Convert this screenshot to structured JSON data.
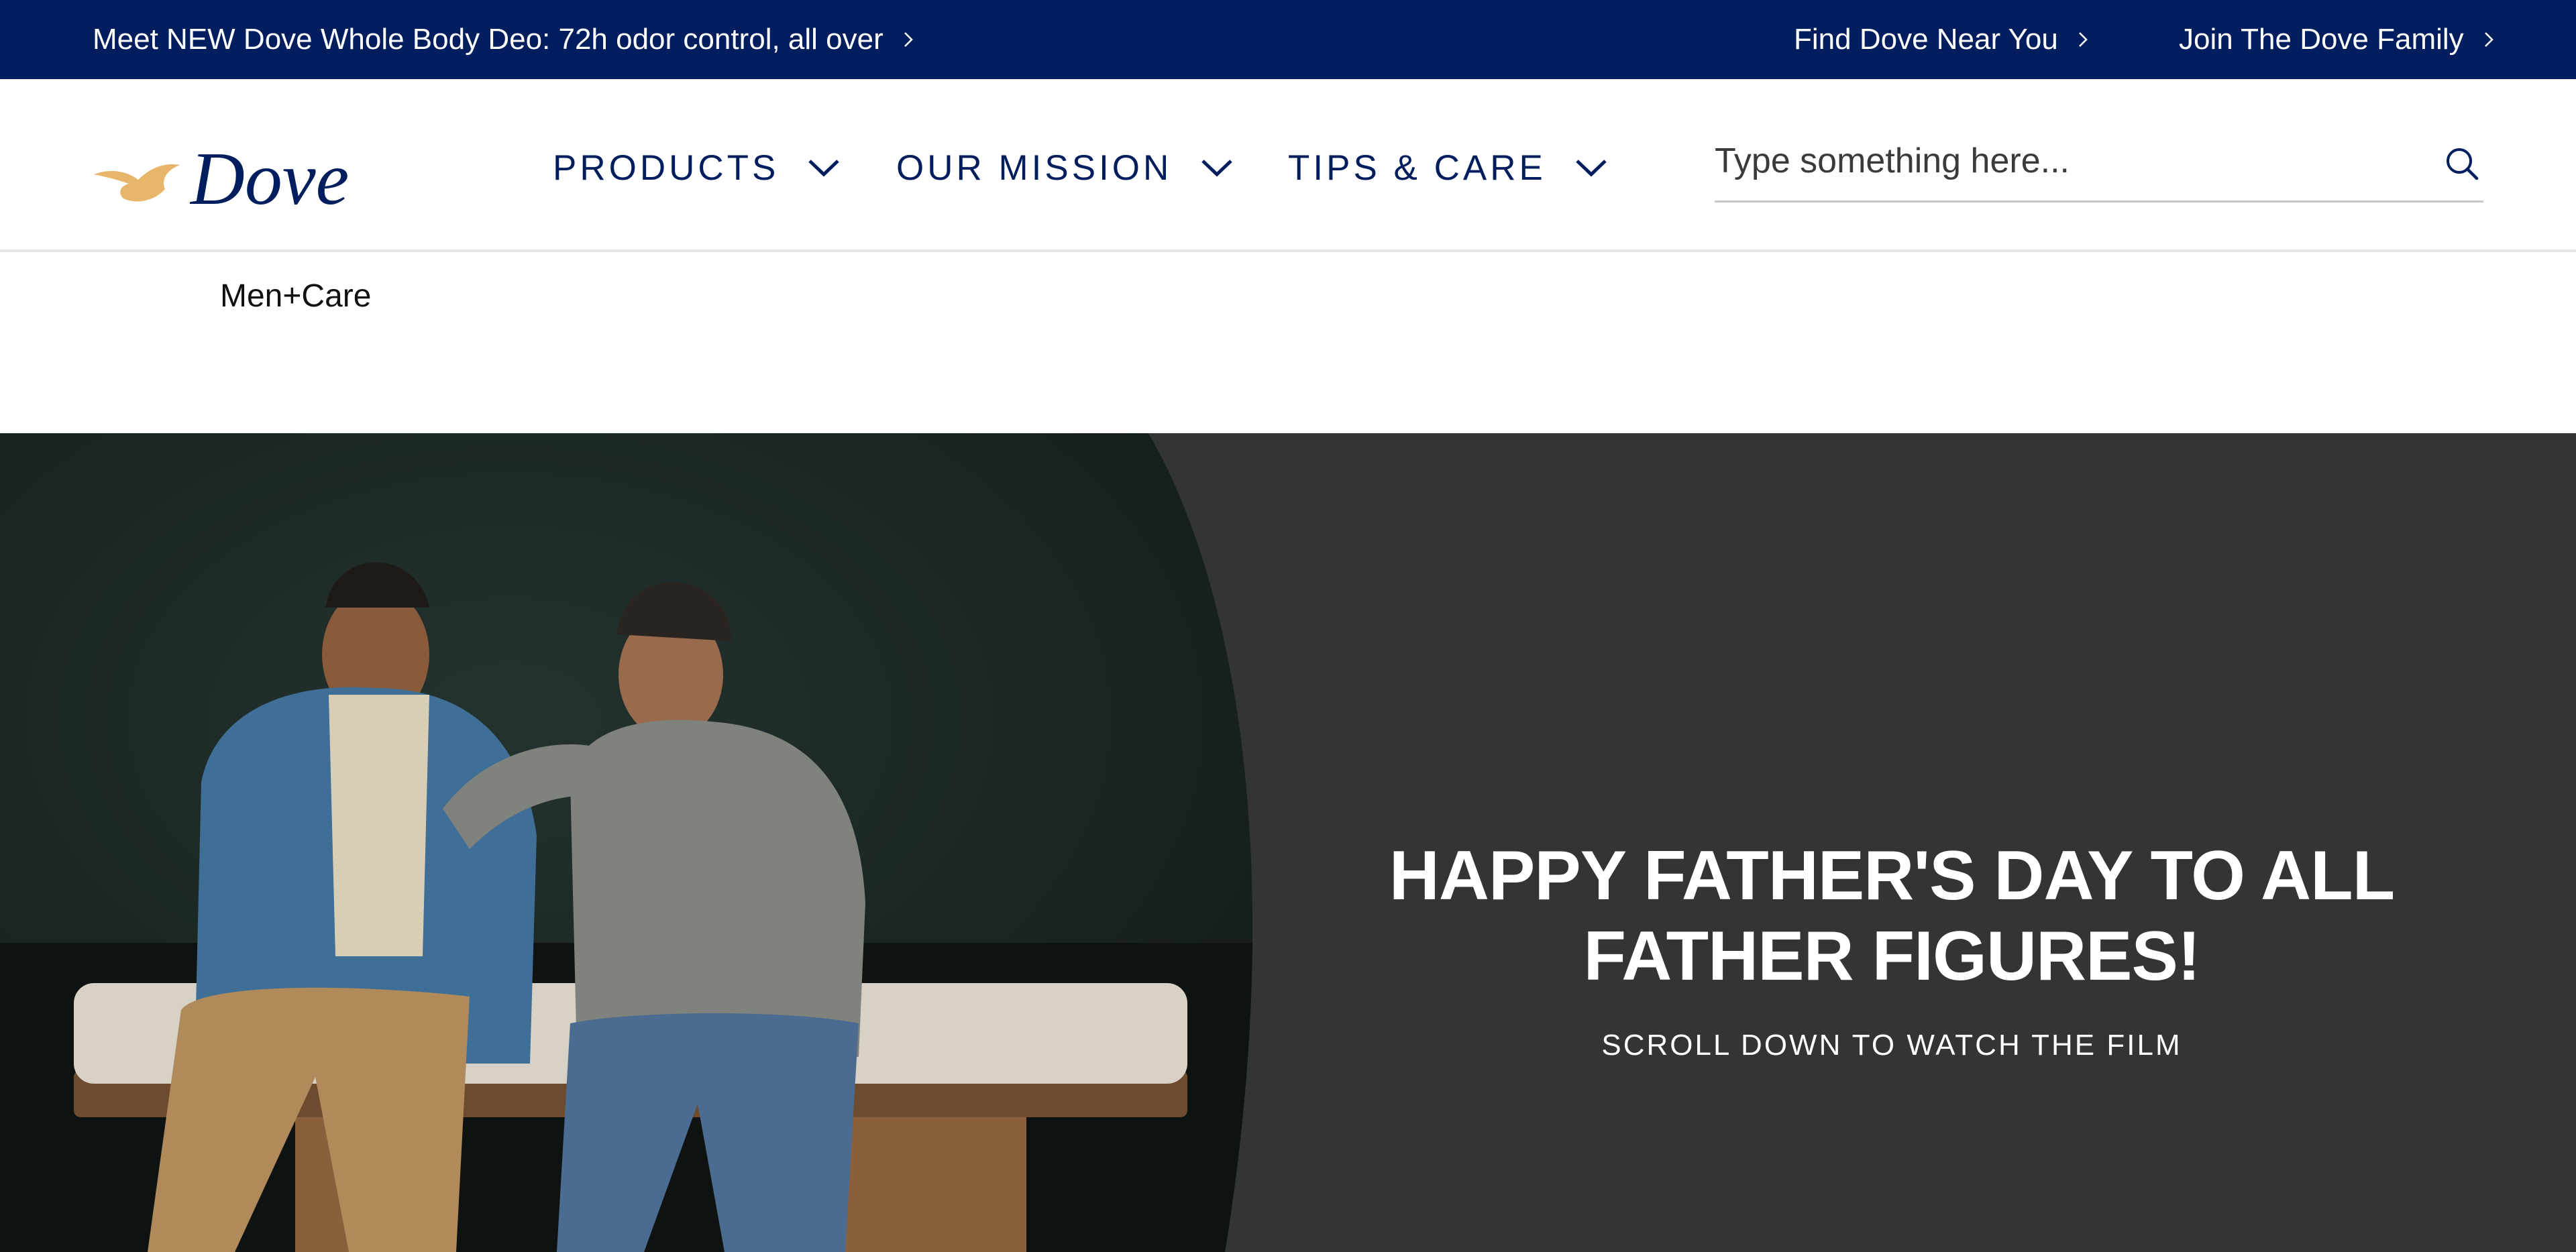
{
  "topbar": {
    "promo_text": "Meet NEW Dove Whole Body Deo: 72h odor control, all over",
    "find_link": "Find Dove Near You",
    "join_link": "Join The Dove Family",
    "background_color": "#001e5e",
    "chevron_icon": "chevron-right-icon"
  },
  "header": {
    "logo_text": "Dove",
    "nav": [
      {
        "label": "PRODUCTS",
        "icon": "chevron-down-icon"
      },
      {
        "label": "OUR MISSION",
        "icon": "chevron-down-icon"
      },
      {
        "label": "TIPS & CARE",
        "icon": "chevron-down-icon"
      }
    ],
    "search": {
      "placeholder": "Type something here...",
      "value": "",
      "icon": "search-icon"
    },
    "brand_color": "#001e5e",
    "logo_bird_color": "#e8b66a"
  },
  "breadcrumb": {
    "label": "Men+Care"
  },
  "hero": {
    "title": "HAPPY FATHER'S DAY TO ALL FATHER FIGURES!",
    "subtitle": "SCROLL DOWN TO WATCH THE FILM",
    "background_color": "#323436",
    "image_description_icon": "hero-photo"
  }
}
